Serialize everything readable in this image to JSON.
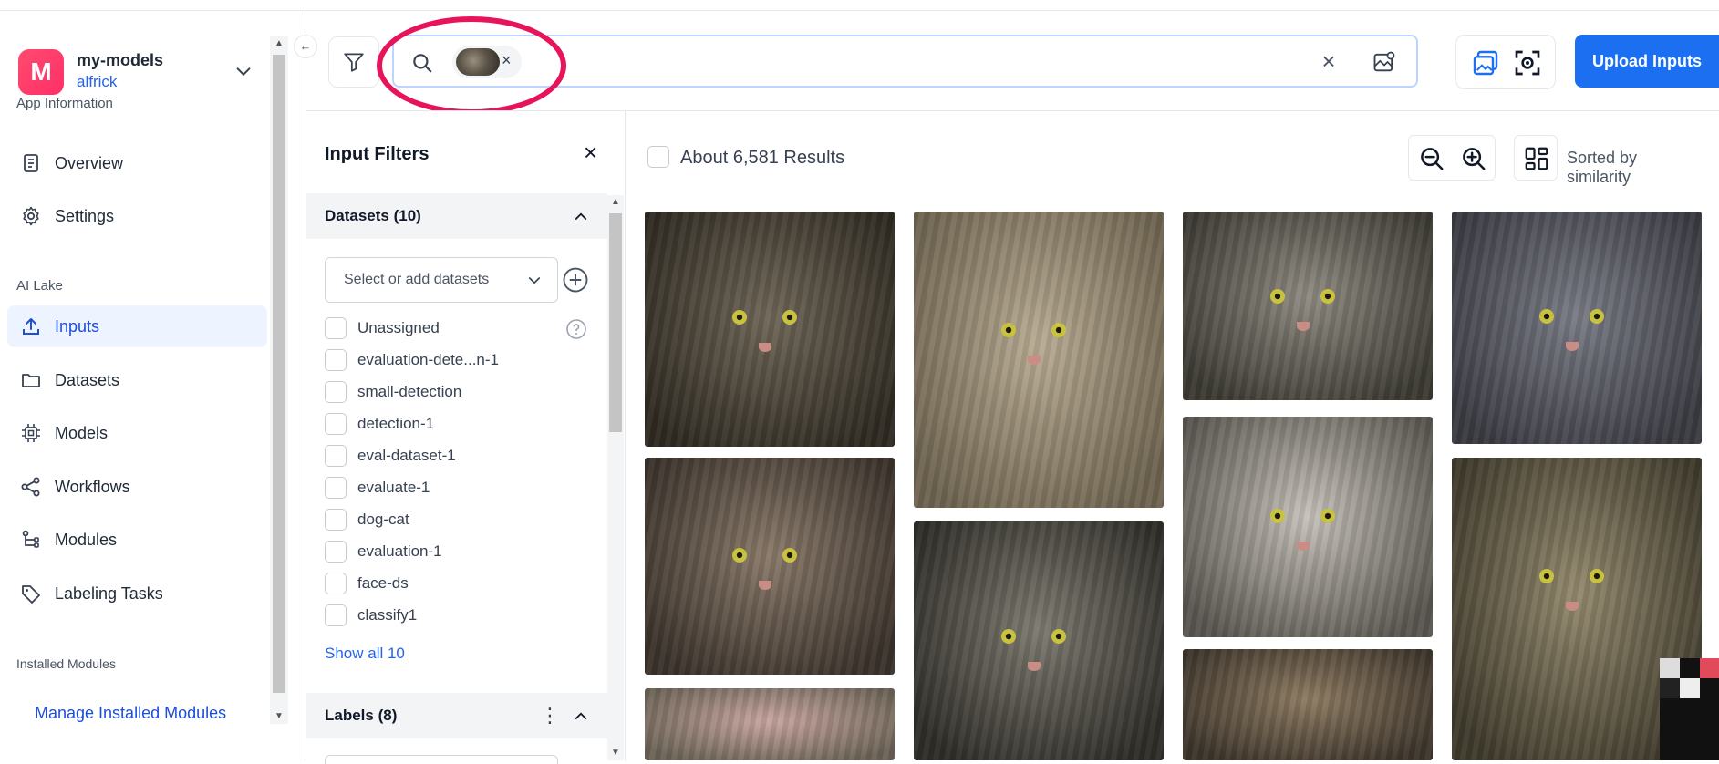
{
  "app": {
    "avatar_letter": "M",
    "name": "my-models",
    "user": "alfrick"
  },
  "sidebar": {
    "section_app_info": "App Information",
    "overview": "Overview",
    "settings": "Settings",
    "section_ai_lake": "AI Lake",
    "inputs": "Inputs",
    "datasets": "Datasets",
    "models": "Models",
    "workflows": "Workflows",
    "modules": "Modules",
    "labeling_tasks": "Labeling Tasks",
    "section_installed": "Installed Modules",
    "manage_modules": "Manage Installed Modules"
  },
  "toolbar": {
    "upload_label": "Upload Inputs",
    "search_chip_remove": "×",
    "clear_symbol": "×"
  },
  "filters": {
    "title": "Input Filters",
    "close_symbol": "×",
    "datasets_header": "Datasets (10)",
    "datasets_placeholder": "Select or add datasets",
    "dataset_items": [
      "Unassigned",
      "evaluation-dete...n-1",
      "small-detection",
      "detection-1",
      "eval-dataset-1",
      "evaluate-1",
      "dog-cat",
      "evaluation-1",
      "face-ds",
      "classify1"
    ],
    "show_all": "Show all 10",
    "labels_header": "Labels (8)"
  },
  "results": {
    "count": "About 6,581 Results",
    "sort": "Sorted by similarity"
  },
  "colors": {
    "accent": "#1d6ff2",
    "highlight_ring": "#e8145a",
    "active_nav_bg": "#eef4ff",
    "avatar": "#ff3d6b"
  },
  "icons": {
    "filter": "filter-funnel-icon",
    "search": "search-icon",
    "image_search": "image-search-icon",
    "gallery": "gallery-icon",
    "scan": "scan-icon",
    "zoom_out": "zoom-out-icon",
    "zoom_in": "zoom-in-icon",
    "layout": "grid-layout-icon"
  }
}
